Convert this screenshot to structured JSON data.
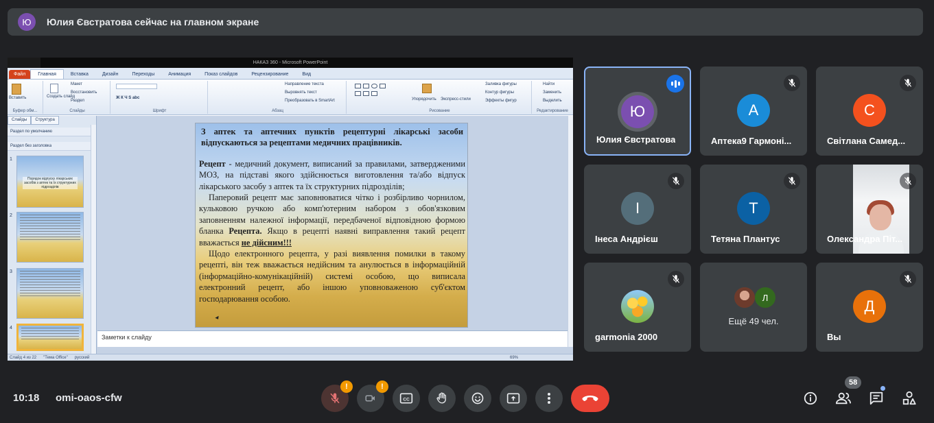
{
  "banner": {
    "avatar_letter": "Ю",
    "text": "Юлия Євстратова сейчас на главном экране"
  },
  "ppt": {
    "window_title": "НАКАЗ 360 - Microsoft PowerPoint",
    "file_tab": "Файл",
    "tabs": [
      "Главная",
      "Вставка",
      "Дизайн",
      "Переходы",
      "Анимация",
      "Показ слайдов",
      "Рецензирование",
      "Вид"
    ],
    "ribbon": {
      "paste": "Вставить",
      "clipboard": "Буфер обм...",
      "create_slide": "Создать слайд",
      "layout": "Макет",
      "reset": "Восстановить",
      "section": "Раздел",
      "slides_group": "Слайды",
      "font_group": "Шрифт",
      "paragraph_group": "Абзац",
      "text_direction": "Направление текста",
      "align_text": "Выровнять текст",
      "smartart": "Преобразовать в SmartArt",
      "arrange": "Упорядочить",
      "quick_styles": "Экспресс-стили",
      "shape_fill": "Заливка фигуры",
      "shape_outline": "Контур фигуры",
      "shape_effects": "Эффекты фигур",
      "drawing_group": "Рисование",
      "find": "Найти",
      "replace": "Заменить",
      "select": "Выделить",
      "editing_group": "Редактирование"
    },
    "side_tabs": [
      "Слайды",
      "Структура"
    ],
    "sections": [
      "Раздел по умолчанию",
      "Раздел без заголовка"
    ],
    "thumb_nums": [
      "1",
      "2",
      "3",
      "4"
    ],
    "thumb1_text": "Порядок відпуску лікарських засобів з аптек та їх структурних підрозділів",
    "slide": {
      "title": "З аптек та аптечних пунктів рецептурні лікарські засоби відпускаються за рецептами медичних працівників.",
      "p1_bold": "Рецепт",
      "p1_rest": " - медичний документ, виписаний за правилами, затвердженими МОЗ, на підставі якого здійснюється виготовлення та/або відпуск лікарського засобу з аптек та їх структурних підрозділів;",
      "p2_start": "Паперовий рецепт має заповнюватися чітко і розбірливо чорнилом, кульковою ручкою або комп'ютерним набором з обов'язковим заповненням належної інформації, передбаченої відповідною формою бланка ",
      "p2_bold": "Рецепта.",
      "p2_mid": " Якщо в рецепті наявні виправлення такий рецепт вважається ",
      "p2_bold2": "не дійсним!!!",
      "p3": "Щодо електронного рецепта, у разі виявлення помилки в такому рецепті, він теж вважається недійсним та анулюється в інформаційній (інформаційно-комунікаційній) системі особою, що виписала електронний рецепт, або іншою уповноваженою суб'єктом господарювання особою."
    },
    "notes_placeholder": "Заметки к слайду",
    "status": {
      "slide": "Слайд 4 из 22",
      "theme": "\"Тема Office\"",
      "lang": "русский",
      "zoom": "69%"
    }
  },
  "participants": [
    {
      "name": "Юлия Євстратова",
      "letter": "Ю",
      "color": "#7b4fb0",
      "speaking": true
    },
    {
      "name": "Аптека9 Гармоні...",
      "letter": "А",
      "color": "#1a8cd8"
    },
    {
      "name": "Світлана Самед...",
      "letter": "С",
      "color": "#f4511e"
    },
    {
      "name": "Інеса Андрієш",
      "letter": "І",
      "color": "#546e7a"
    },
    {
      "name": "Тетяна Плантус",
      "letter": "Т",
      "color": "#0b61a4"
    },
    {
      "name": "Олександра Піт...",
      "video": true
    },
    {
      "name": "garmonia 2000",
      "photo": true
    },
    {
      "more": "Ещё 49 чел.",
      "mini_letter": "Л",
      "mini_color": "#33691e"
    },
    {
      "name": "Вы",
      "letter": "Д",
      "color": "#e8710a"
    }
  ],
  "bottom": {
    "time": "10:18",
    "meeting_code": "omi-oaos-cfw",
    "warning_mark": "!",
    "people_count": "58"
  },
  "icons": [
    "mic-off-icon",
    "camera-off-icon",
    "captions-icon",
    "raise-hand-icon",
    "emoji-icon",
    "present-icon",
    "more-options-icon",
    "end-call-icon",
    "info-icon",
    "people-icon",
    "chat-icon",
    "activities-icon"
  ]
}
